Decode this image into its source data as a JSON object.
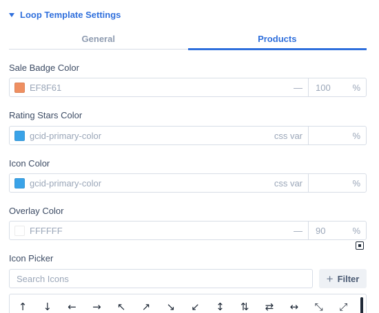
{
  "section": {
    "title": "Loop Template Settings"
  },
  "tabs": [
    {
      "label": "General",
      "active": false
    },
    {
      "label": "Products",
      "active": true
    }
  ],
  "fields": {
    "sale_badge": {
      "label": "Sale Badge Color",
      "value": "EF8F61",
      "swatch": "#ef8f61",
      "suffix": "—",
      "opacity": "100",
      "unit": "%"
    },
    "rating_stars": {
      "label": "Rating Stars Color",
      "value": "gcid-primary-color",
      "swatch": "#3aa3e8",
      "suffix": "css var",
      "opacity": "",
      "unit": "%"
    },
    "icon_color": {
      "label": "Icon Color",
      "value": "gcid-primary-color",
      "swatch": "#3aa3e8",
      "suffix": "css var",
      "opacity": "",
      "unit": "%"
    },
    "overlay": {
      "label": "Overlay Color",
      "value": "FFFFFF",
      "swatch": "#ffffff",
      "suffix": "—",
      "opacity": "90",
      "unit": "%"
    }
  },
  "icon_picker": {
    "label": "Icon Picker",
    "search_placeholder": "Search Icons",
    "filter_label": "Filter",
    "icons": [
      {
        "name": "arrow-up-icon",
        "glyph": "↑"
      },
      {
        "name": "arrow-down-icon",
        "glyph": "↓"
      },
      {
        "name": "arrow-left-icon",
        "glyph": "←"
      },
      {
        "name": "arrow-right-icon",
        "glyph": "→"
      },
      {
        "name": "arrow-up-left-icon",
        "glyph": "↖"
      },
      {
        "name": "arrow-up-right-icon",
        "glyph": "↗"
      },
      {
        "name": "arrow-down-right-icon",
        "glyph": "↘"
      },
      {
        "name": "arrow-down-left-icon",
        "glyph": "↙"
      },
      {
        "name": "arrows-vertical-icon",
        "glyph": "↕"
      },
      {
        "name": "arrows-up-down-icon",
        "glyph": "⇅"
      },
      {
        "name": "arrows-swap-horizontal-icon",
        "glyph": "⇄"
      },
      {
        "name": "arrows-horizontal-icon",
        "glyph": "↔"
      },
      {
        "name": "arrows-diagonal-icon",
        "glyph": "⤡"
      },
      {
        "name": "arrows-expand-icon",
        "glyph": "⤢"
      }
    ]
  },
  "colors": {
    "accent": "#2f6fdc",
    "border": "#d7dde6",
    "muted": "#9aa6b8",
    "label": "#3b4a63"
  }
}
